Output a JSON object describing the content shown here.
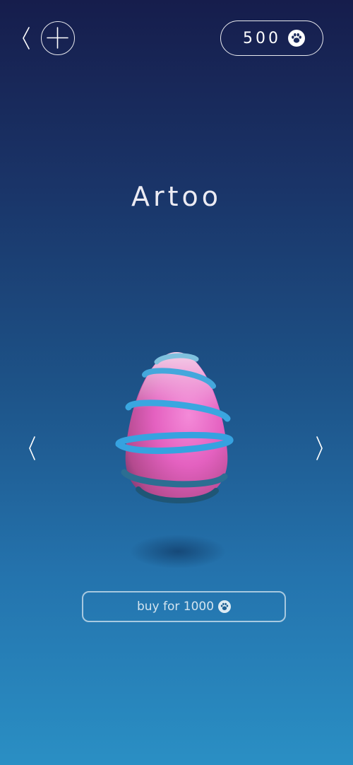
{
  "header": {
    "back_icon": "chevron-left-icon",
    "add_icon": "plus-icon",
    "balance": "500",
    "currency_icon": "paw-coin-icon"
  },
  "pet": {
    "name": "Artoo",
    "image": "pink-egg-with-blue-rings"
  },
  "navigation": {
    "prev_icon": "chevron-left-icon",
    "next_icon": "chevron-right-icon"
  },
  "purchase": {
    "label": "buy for 1000",
    "currency_icon": "paw-coin-icon"
  },
  "colors": {
    "bg_top": "#161d4c",
    "bg_bottom": "#2a8fc4",
    "egg_pink": "#e860c4",
    "ring_blue": "#3aa6e0"
  }
}
